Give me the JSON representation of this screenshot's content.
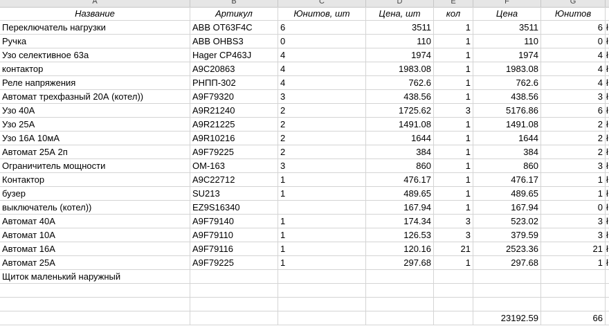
{
  "column_letters": [
    "A",
    "B",
    "C",
    "D",
    "E",
    "F",
    "G"
  ],
  "headers": [
    "Название",
    "Артикул",
    "Юнитов, шт",
    "Цена, шт",
    "кол",
    "Цена",
    "Юнитов"
  ],
  "rows": [
    {
      "name": "Переключатель нагрузки",
      "sku": "ABB OT63F4C",
      "units": "6",
      "price": "3511",
      "qty": "1",
      "total": "3511",
      "total_units": "6",
      "h": "ł"
    },
    {
      "name": "Ручка",
      "sku": "ABB OHBS3",
      "units": "0",
      "price": "110",
      "qty": "1",
      "total": "110",
      "total_units": "0",
      "h": "ł"
    },
    {
      "name": "Узо селективное 63а",
      "sku": "Hager CP463J",
      "units": "4",
      "price": "1974",
      "qty": "1",
      "total": "1974",
      "total_units": "4",
      "h": "ł"
    },
    {
      "name": "контактор",
      "sku": "A9C20863",
      "units": "4",
      "price": "1983.08",
      "qty": "1",
      "total": "1983.08",
      "total_units": "4",
      "h": "ł"
    },
    {
      "name": "Реле напряжения",
      "sku": "РНПП-302",
      "units": "4",
      "price": "762.6",
      "qty": "1",
      "total": "762.6",
      "total_units": "4",
      "h": "ł"
    },
    {
      "name": "Автомат трехфазный 20А (котел))",
      "sku": "A9F79320",
      "units": "3",
      "price": "438.56",
      "qty": "1",
      "total": "438.56",
      "total_units": "3",
      "h": "ł"
    },
    {
      "name": "Узо 40А",
      "sku": "A9R21240",
      "units": "2",
      "price": "1725.62",
      "qty": "3",
      "total": "5176.86",
      "total_units": "6",
      "h": "ł"
    },
    {
      "name": "Узо 25А",
      "sku": "A9R21225",
      "units": "2",
      "price": "1491.08",
      "qty": "1",
      "total": "1491.08",
      "total_units": "2",
      "h": "ł"
    },
    {
      "name": "Узо 16А 10мА",
      "sku": "A9R10216",
      "units": "2",
      "price": "1644",
      "qty": "1",
      "total": "1644",
      "total_units": "2",
      "h": "ł"
    },
    {
      "name": "Автомат 25А 2п",
      "sku": "A9F79225",
      "units": "2",
      "price": "384",
      "qty": "1",
      "total": "384",
      "total_units": "2",
      "h": "ł"
    },
    {
      "name": "Ограничитель мощности",
      "sku": "OM-163",
      "units": "3",
      "price": "860",
      "qty": "1",
      "total": "860",
      "total_units": "3",
      "h": "ł"
    },
    {
      "name": "Контактор",
      "sku": "A9C22712",
      "units": "1",
      "price": "476.17",
      "qty": "1",
      "total": "476.17",
      "total_units": "1",
      "h": "ł"
    },
    {
      "name": "бузер",
      "sku": "SU213",
      "units": "1",
      "price": "489.65",
      "qty": "1",
      "total": "489.65",
      "total_units": "1",
      "h": "ł"
    },
    {
      "name": "выключатель (котел))",
      "sku": "EZ9S16340",
      "units": "",
      "price": "167.94",
      "qty": "1",
      "total": "167.94",
      "total_units": "0",
      "h": "ł"
    },
    {
      "name": "Автомат 40А",
      "sku": "A9F79140",
      "units": "1",
      "price": "174.34",
      "qty": "3",
      "total": "523.02",
      "total_units": "3",
      "h": "ł"
    },
    {
      "name": "Автомат 10А",
      "sku": "A9F79110",
      "units": "1",
      "price": "126.53",
      "qty": "3",
      "total": "379.59",
      "total_units": "3",
      "h": "ł"
    },
    {
      "name": "Автомат 16А",
      "sku": "A9F79116",
      "units": "1",
      "price": "120.16",
      "qty": "21",
      "total": "2523.36",
      "total_units": "21",
      "h": "ł"
    },
    {
      "name": "Автомат 25А",
      "sku": "A9F79225",
      "units": "1",
      "price": "297.68",
      "qty": "1",
      "total": "297.68",
      "total_units": "1",
      "h": "ł"
    },
    {
      "name": "Щиток маленький наружный",
      "sku": "",
      "units": "",
      "price": "",
      "qty": "",
      "total": "",
      "total_units": "",
      "h": ""
    }
  ],
  "totals": {
    "sum_price": "23192.59",
    "sum_units": "66"
  }
}
